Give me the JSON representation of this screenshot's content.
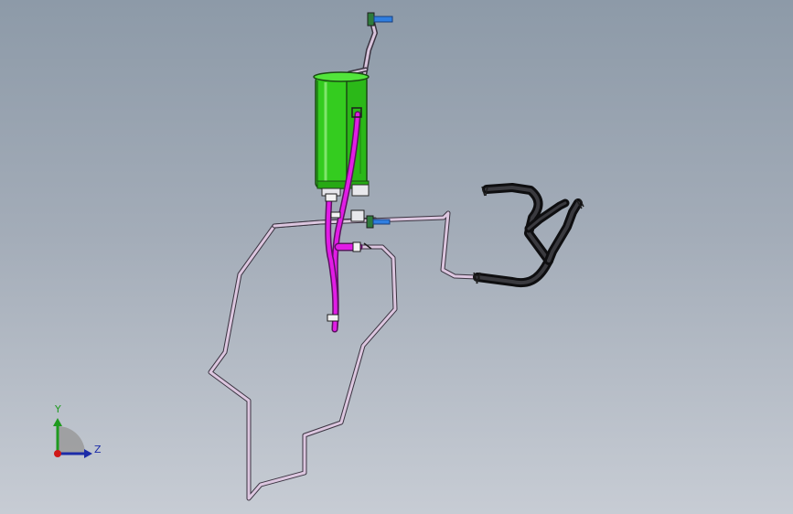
{
  "viewport": {
    "background_top": "#8d9aa8",
    "background_bottom": "#c7ccd4"
  },
  "model": {
    "canister_color": "#33cc1f",
    "purge_line_color": "#e21ce6",
    "vapor_line_color": "#d9c4dc",
    "outline_color": "#3a3340",
    "rubber_hose_color": "#1e1e20",
    "fastener_color": "#2f7ee0",
    "clip_color": "#2a9a2a"
  },
  "triad": {
    "y_label": "Y",
    "z_label": "Z",
    "y_color": "#1f9a1f",
    "z_color": "#1c2ca8",
    "origin_color": "#d01818",
    "plane_color": "#9a9a9a"
  }
}
